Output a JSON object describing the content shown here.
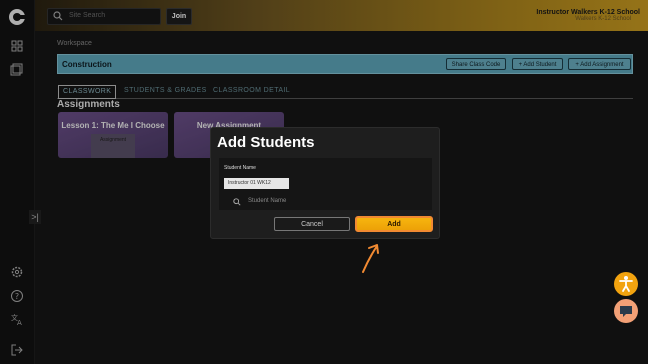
{
  "topbar": {
    "search_placeholder": "Site Search",
    "join_label": "Join",
    "user_name": "Instructor Walkers K-12 School",
    "user_school": "Walkers K-12 School"
  },
  "workspace": {
    "label": "Workspace",
    "class_title": "Construction",
    "buttons": [
      "Share Class Code",
      "+ Add Student",
      "+ Add Assignment"
    ]
  },
  "tabs": [
    "CLASSWORK",
    "STUDENTS & GRADES",
    "CLASSROOM DETAIL"
  ],
  "assignments_heading": "Assignments",
  "cards": [
    {
      "title": "Lesson 1: The Me I Choose",
      "art_label": "Assignment"
    },
    {
      "title": "New Assignment",
      "art_label": ""
    }
  ],
  "modal": {
    "title": "Add Students",
    "field_label": "Student Name",
    "chip": "Instructor 01 WK12",
    "search_placeholder": "Student Name",
    "cancel_label": "Cancel",
    "add_label": "Add"
  },
  "colors": {
    "accent": "#f2a30f",
    "banner": "#5da4b9",
    "card": "#5a4378"
  },
  "icons": [
    "logo-icon",
    "dashboard-icon",
    "library-icon",
    "settings-icon",
    "help-icon",
    "translate-icon",
    "logout-icon",
    "accessibility-icon",
    "chat-icon"
  ]
}
